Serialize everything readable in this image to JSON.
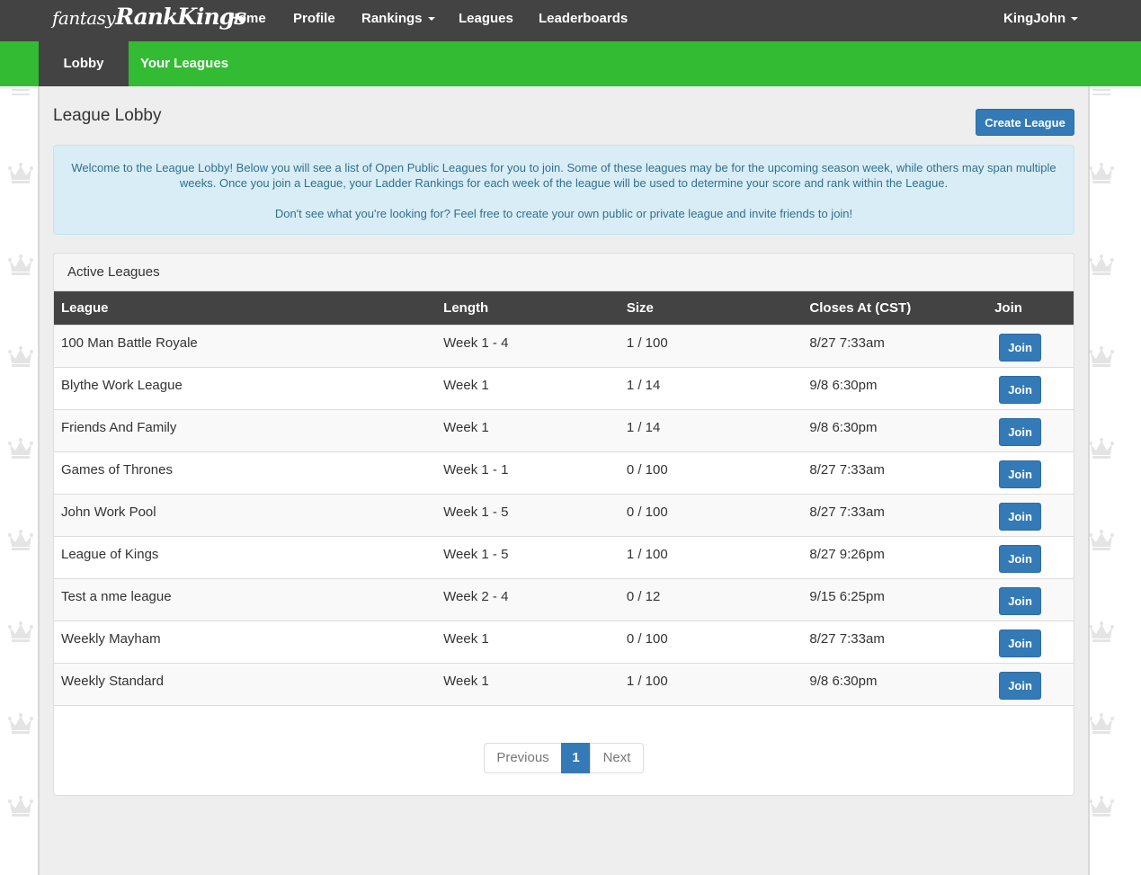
{
  "brand": {
    "part1": "fantasy",
    "part2": "RankKings"
  },
  "topnav": {
    "home": "Home",
    "profile": "Profile",
    "rankings": "Rankings",
    "leagues": "Leagues",
    "leaderboards": "Leaderboards",
    "user": "KingJohn"
  },
  "subnav": {
    "lobby": "Lobby",
    "your_leagues": "Your Leagues"
  },
  "page": {
    "title": "League Lobby",
    "create_button": "Create League",
    "alert_p1": "Welcome to the League Lobby! Below you will see a list of Open Public Leagues for you to join. Some of these leagues may be for the upcoming season week, while others may span multiple weeks. Once you join a League, your Ladder Rankings for each week of the league will be used to determine your score and rank within the League.",
    "alert_p2": "Don't see what you're looking for? Feel free to create your own public or private league and invite friends to join!"
  },
  "panel": {
    "heading": "Active Leagues"
  },
  "table": {
    "headers": [
      "League",
      "Length",
      "Size",
      "Closes At (CST)",
      "Join"
    ],
    "join_label": "Join",
    "rows": [
      {
        "league": "100 Man Battle Royale",
        "length": "Week 1 - 4",
        "size": "1 / 100",
        "closes": "8/27 7:33am"
      },
      {
        "league": "Blythe Work League",
        "length": "Week 1",
        "size": "1 / 14",
        "closes": "9/8 6:30pm"
      },
      {
        "league": "Friends And Family",
        "length": "Week 1",
        "size": "1 / 14",
        "closes": "9/8 6:30pm"
      },
      {
        "league": "Games of Thrones",
        "length": "Week 1 - 1",
        "size": "0 / 100",
        "closes": "8/27 7:33am"
      },
      {
        "league": "John Work Pool",
        "length": "Week 1 - 5",
        "size": "0 / 100",
        "closes": "8/27 7:33am"
      },
      {
        "league": "League of Kings",
        "length": "Week 1 - 5",
        "size": "1 / 100",
        "closes": "8/27 9:26pm"
      },
      {
        "league": "Test a nme league",
        "length": "Week 2 - 4",
        "size": "0 / 12",
        "closes": "9/15 6:25pm"
      },
      {
        "league": "Weekly Mayham",
        "length": "Week 1",
        "size": "0 / 100",
        "closes": "8/27 7:33am"
      },
      {
        "league": "Weekly Standard",
        "length": "Week 1",
        "size": "1 / 100",
        "closes": "9/8 6:30pm"
      }
    ]
  },
  "pagination": {
    "previous": "Previous",
    "current": "1",
    "next": "Next"
  },
  "colors": {
    "navbar": "#434343",
    "subnav": "#33bb33",
    "primary": "#337ab7",
    "alert_bg": "#d9edf7",
    "alert_text": "#31708f"
  }
}
